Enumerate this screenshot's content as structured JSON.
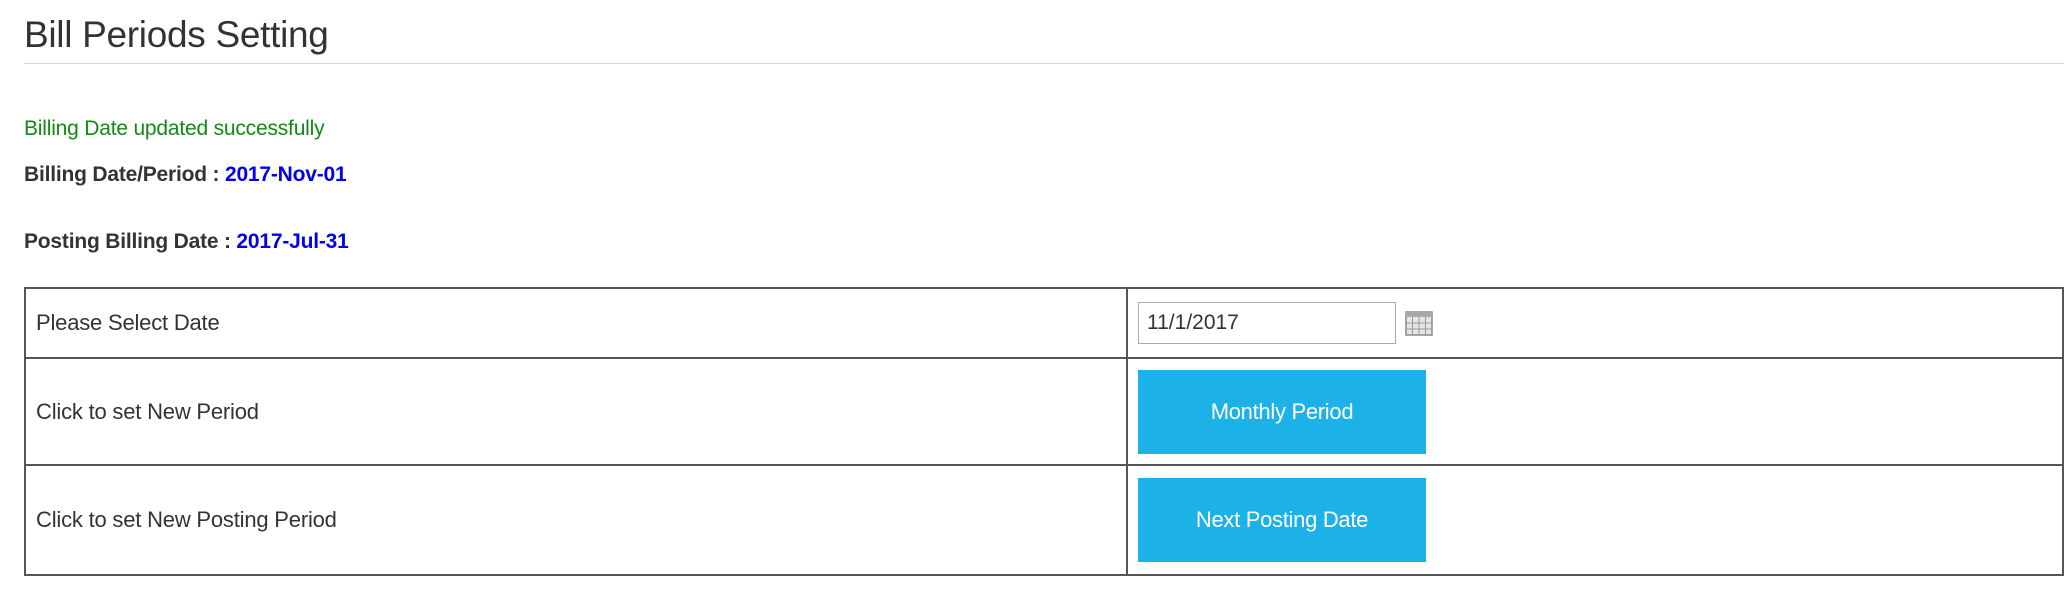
{
  "page": {
    "title": "Bill Periods Setting"
  },
  "status": {
    "success_message": "Billing Date updated successfully"
  },
  "billing": {
    "label": "Billing Date/Period : ",
    "value": "2017-Nov-01"
  },
  "posting": {
    "label": "Posting Billing Date : ",
    "value": "2017-Jul-31"
  },
  "form": {
    "rows": [
      {
        "label": "Please Select Date"
      },
      {
        "label": "Click to set New Period"
      },
      {
        "label": "Click to set New Posting Period"
      }
    ],
    "date_value": "11/1/2017",
    "monthly_period_button": "Monthly Period",
    "next_posting_date_button": "Next Posting Date"
  },
  "colors": {
    "success": "#138a13",
    "value_link": "#0000ee",
    "button_bg": "#1cb2e8"
  }
}
